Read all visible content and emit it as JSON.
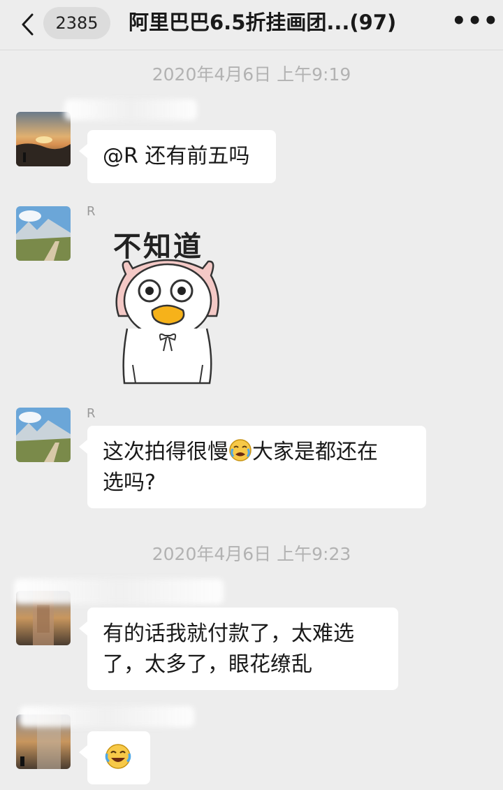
{
  "nav": {
    "back_icon": "chevron-left-icon",
    "unread_count": "2385",
    "title": "阿里巴巴6.5折挂画团...(97)",
    "more_icon": "more-dots-icon",
    "more_label": "•••"
  },
  "timestamps": [
    "2020年4月6日 上午9:19",
    "2020年4月6日 上午9:23"
  ],
  "messages": [
    {
      "sender": "",
      "text": "@R 还有前五吗",
      "avatar": "sunset-avatar"
    },
    {
      "sender": "R",
      "sticker_text": "不知道",
      "sticker": "pig-hood-duck-sticker",
      "avatar": "mountain-avatar"
    },
    {
      "sender": "R",
      "text_line1": "这次拍得很慢",
      "emoji": "crying-face-emoji",
      "text_line1b": "大家是都还在",
      "text_line2": "选吗?",
      "avatar": "mountain-avatar"
    },
    {
      "sender": "",
      "text_line1": "有的话我就付款了，太难选",
      "text_line2": "了，太多了，眼花缭乱",
      "avatar": "blurred-avatar"
    },
    {
      "sender": "",
      "emoji": "laughing-tears-emoji",
      "avatar": "blurred-avatar"
    }
  ],
  "colors": {
    "background": "#ededed",
    "bubble": "#ffffff",
    "timestamp": "#b2b2b2",
    "text": "#191919"
  }
}
